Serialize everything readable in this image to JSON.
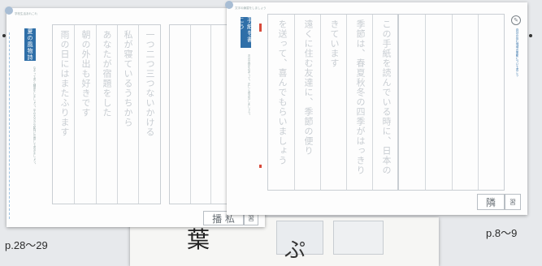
{
  "captions": {
    "left": "p.28～29",
    "right": "p.8～9"
  },
  "left_page": {
    "header": "学校生活あれこれ",
    "tab": "夏の風物詩",
    "instructions": "なぞって書く練習をしましょう。字の大きさや配列に注意して書きましょう。",
    "lines": [
      "一つ二つ三つないかける",
      "私が寝ているうちから",
      "あなたが宿題をした",
      "朝の外出も好きです",
      "雨の日にはまたふります"
    ],
    "footer_name": "播 私",
    "footer_mark": "習"
  },
  "right_page": {
    "header": "文字の練習をしましょう",
    "tab": "手紙を書こう",
    "instructions": "次の文章をなぞって、正しく書き写しましょう。",
    "lines": [
      "この手紙を読んでいる時に、日本の",
      "季節は、春夏秋冬の四季がはっきり",
      "きています",
      "遠くに住む友達に、季節の便り",
      "を送って、喜んでもらいましょう"
    ],
    "side_note": "自分の住む地域の季節について書こう",
    "footer_name": "隣",
    "footer_mark": "習"
  },
  "bottom_strip": {
    "big_char": "葉",
    "small_char": "ぷ"
  }
}
